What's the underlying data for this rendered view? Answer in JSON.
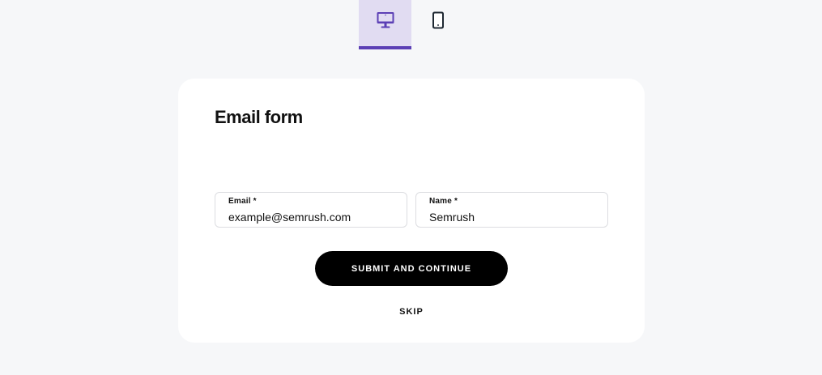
{
  "device_tabs": {
    "items": [
      {
        "id": "desktop",
        "icon": "monitor-icon",
        "active": true
      },
      {
        "id": "mobile",
        "icon": "phone-icon",
        "active": false
      }
    ],
    "active_color": "#5b3fb5",
    "active_background": "#e1dcf2"
  },
  "form": {
    "title": "Email form",
    "fields": [
      {
        "label": "Email *",
        "value": "example@semrush.com"
      },
      {
        "label": "Name *",
        "value": "Semrush"
      }
    ],
    "submit_label": "SUBMIT AND CONTINUE",
    "skip_label": "SKIP"
  },
  "colors": {
    "page_background": "#f6f7f9",
    "card_background": "#ffffff",
    "button_background": "#000000",
    "button_text": "#ffffff"
  }
}
